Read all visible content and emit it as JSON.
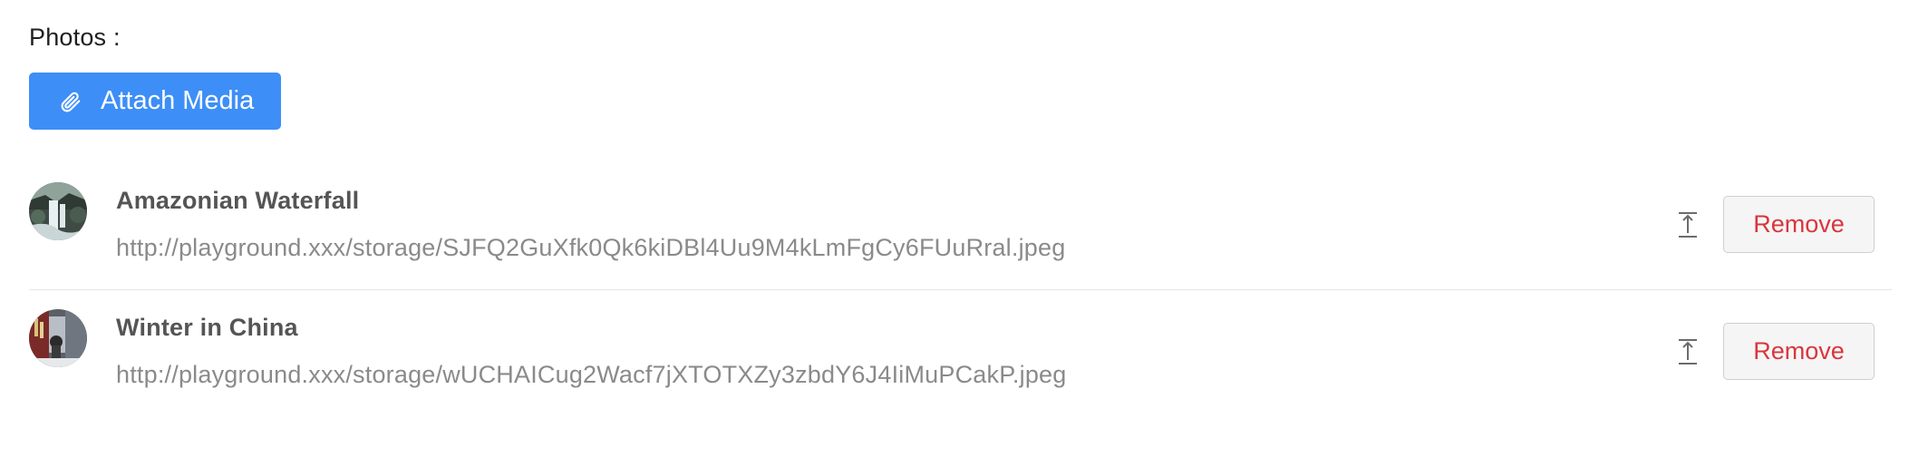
{
  "field": {
    "label": "Photos :"
  },
  "attach": {
    "label": "Attach Media",
    "icon": "paperclip-icon"
  },
  "media": [
    {
      "title": "Amazonian Waterfall",
      "url": "http://playground.xxx/storage/SJFQ2GuXfk0Qk6kiDBl4Uu9M4kLmFgCy6FUuRral.jpeg",
      "remove_label": "Remove"
    },
    {
      "title": "Winter in China",
      "url": "http://playground.xxx/storage/wUCHAICug2Wacf7jXTOTXZy3zbdY6J4IiMuPCakP.jpeg",
      "remove_label": "Remove"
    }
  ],
  "colors": {
    "primary": "#3d8ef7",
    "danger": "#d9363e",
    "muted_text": "#8a8a8a",
    "divider": "#e6e6e6"
  }
}
